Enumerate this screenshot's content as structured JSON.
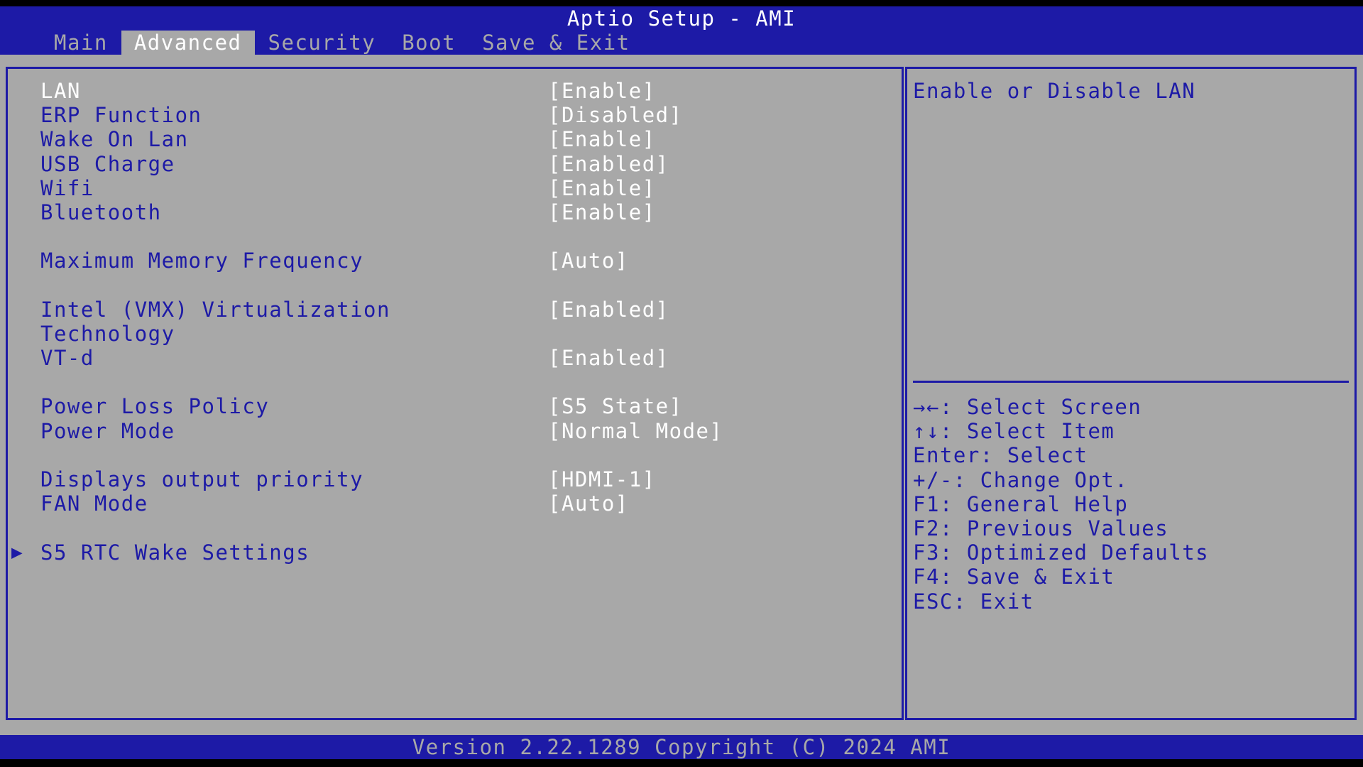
{
  "header": {
    "title": "Aptio Setup - AMI"
  },
  "tabs": [
    {
      "label": "Main",
      "active": false
    },
    {
      "label": "Advanced",
      "active": true
    },
    {
      "label": "Security",
      "active": false
    },
    {
      "label": "Boot",
      "active": false
    },
    {
      "label": "Save & Exit",
      "active": false
    }
  ],
  "settings": {
    "lan": {
      "label": "LAN",
      "value": "[Enable]",
      "selected": true
    },
    "erp": {
      "label": "ERP Function",
      "value": "[Disabled]"
    },
    "wol": {
      "label": "Wake On Lan",
      "value": "[Enable]"
    },
    "usb_charge": {
      "label": "USB Charge",
      "value": "[Enabled]"
    },
    "wifi": {
      "label": "Wifi",
      "value": "[Enable]"
    },
    "bluetooth": {
      "label": "Bluetooth",
      "value": "[Enable]"
    },
    "max_mem_freq": {
      "label": "Maximum Memory Frequency",
      "value": "[Auto]"
    },
    "vmx": {
      "label": "Intel (VMX) Virtualization Technology",
      "value": "[Enabled]"
    },
    "vtd": {
      "label": "VT-d",
      "value": "[Enabled]"
    },
    "power_loss": {
      "label": "Power Loss Policy",
      "value": "[S5 State]"
    },
    "power_mode": {
      "label": "Power Mode",
      "value": "[Normal Mode]"
    },
    "display_priority": {
      "label": "Displays output priority",
      "value": "[HDMI-1]"
    },
    "fan_mode": {
      "label": "FAN Mode",
      "value": "[Auto]"
    },
    "s5_rtc": {
      "label": "S5 RTC Wake Settings",
      "arrow": "▶"
    }
  },
  "help": {
    "text": "Enable or Disable LAN"
  },
  "keys": [
    "→←: Select Screen",
    "↑↓: Select Item",
    "Enter: Select",
    "+/-: Change Opt.",
    "F1: General Help",
    "F2: Previous Values",
    "F3: Optimized Defaults",
    "F4: Save & Exit",
    "ESC: Exit"
  ],
  "footer": {
    "version": "Version 2.22.1289 Copyright (C) 2024 AMI"
  },
  "colors": {
    "bios_blue": "#1d1aa6",
    "panel_gray": "#a8a8a8",
    "highlight_white": "#ffffff"
  }
}
